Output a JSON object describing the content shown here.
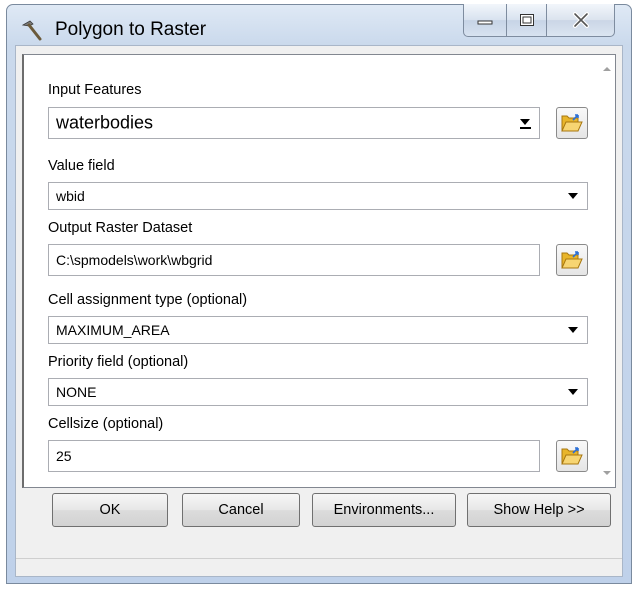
{
  "window": {
    "title": "Polygon to Raster"
  },
  "params": {
    "input_features": {
      "label": "Input Features",
      "value": "waterbodies"
    },
    "value_field": {
      "label": "Value field",
      "value": "wbid"
    },
    "output_raster": {
      "label": "Output Raster Dataset",
      "value": "C:\\spmodels\\work\\wbgrid"
    },
    "cell_assignment": {
      "label": "Cell assignment type (optional)",
      "value": "MAXIMUM_AREA"
    },
    "priority_field": {
      "label": "Priority field (optional)",
      "value": "NONE"
    },
    "cellsize": {
      "label": "Cellsize (optional)",
      "value": "25"
    }
  },
  "buttons": {
    "ok": "OK",
    "cancel": "Cancel",
    "environments": "Environments...",
    "show_help": "Show Help >>"
  },
  "icons": {
    "title": "hammer-icon",
    "browse": "open-folder-icon"
  },
  "colors": {
    "folder": "#e8b52a",
    "folder_dark": "#a8770f",
    "arrow": "#2b6fd6"
  }
}
